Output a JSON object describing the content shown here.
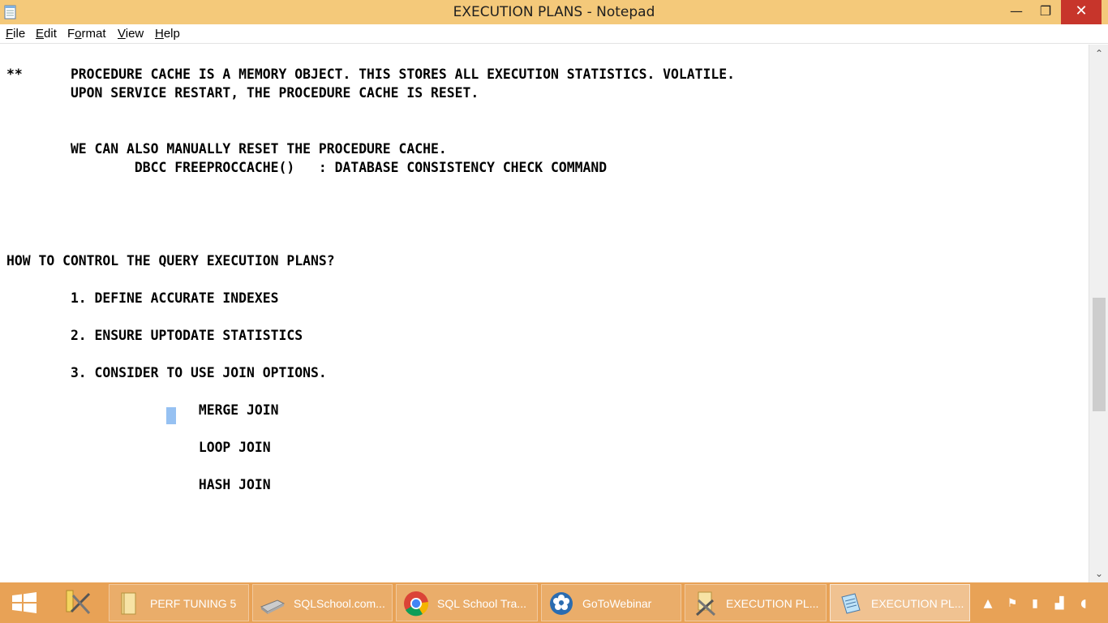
{
  "window": {
    "title": "EXECUTION PLANS - Notepad",
    "controls": {
      "minimize": "—",
      "maximize": "❐",
      "close": "✕"
    }
  },
  "menu": [
    {
      "label": "File",
      "accel": "F",
      "rest": "ile"
    },
    {
      "label": "Edit",
      "accel": "E",
      "rest": "dit"
    },
    {
      "label": "Format",
      "accel": "o",
      "pre": "F",
      "rest": "rmat"
    },
    {
      "label": "View",
      "accel": "V",
      "rest": "iew"
    },
    {
      "label": "Help",
      "accel": "H",
      "rest": "elp"
    }
  ],
  "editor": {
    "lines": [
      "**      PROCEDURE CACHE IS A MEMORY OBJECT. THIS STORES ALL EXECUTION STATISTICS. VOLATILE.",
      "        UPON SERVICE RESTART, THE PROCEDURE CACHE IS RESET.",
      "",
      "",
      "        WE CAN ALSO MANUALLY RESET THE PROCEDURE CACHE.",
      "                DBCC FREEPROCCACHE()   : DATABASE CONSISTENCY CHECK COMMAND",
      "",
      "",
      "",
      "",
      "HOW TO CONTROL THE QUERY EXECUTION PLANS?",
      "",
      "        1. DEFINE ACCURATE INDEXES",
      "",
      "        2. ENSURE UPTODATE STATISTICS",
      "",
      "        3. CONSIDER TO USE JOIN OPTIONS.",
      "",
      "                        MERGE JOIN",
      "",
      "                        LOOP JOIN",
      "",
      "                        HASH JOIN"
    ]
  },
  "scrollbar": {
    "up": "⌃",
    "down": "⌄"
  },
  "taskbar": {
    "items": [
      {
        "label": "PERF TUNING 5",
        "icon": "folder-icon"
      },
      {
        "label": "SQLSchool.com...",
        "icon": "drive-icon"
      },
      {
        "label": "SQL School Tra...",
        "icon": "chrome-icon"
      },
      {
        "label": "GoToWebinar",
        "icon": "gotowebinar-icon"
      },
      {
        "label": "EXECUTION PL...",
        "icon": "doc-tools-icon"
      },
      {
        "label": "EXECUTION PL...",
        "icon": "notepad-icon",
        "active": true
      }
    ]
  },
  "colors": {
    "titlebar": "#f4c97a",
    "taskbar": "#e8a256",
    "close": "#c7352b",
    "selection": "#3f8ee8"
  }
}
